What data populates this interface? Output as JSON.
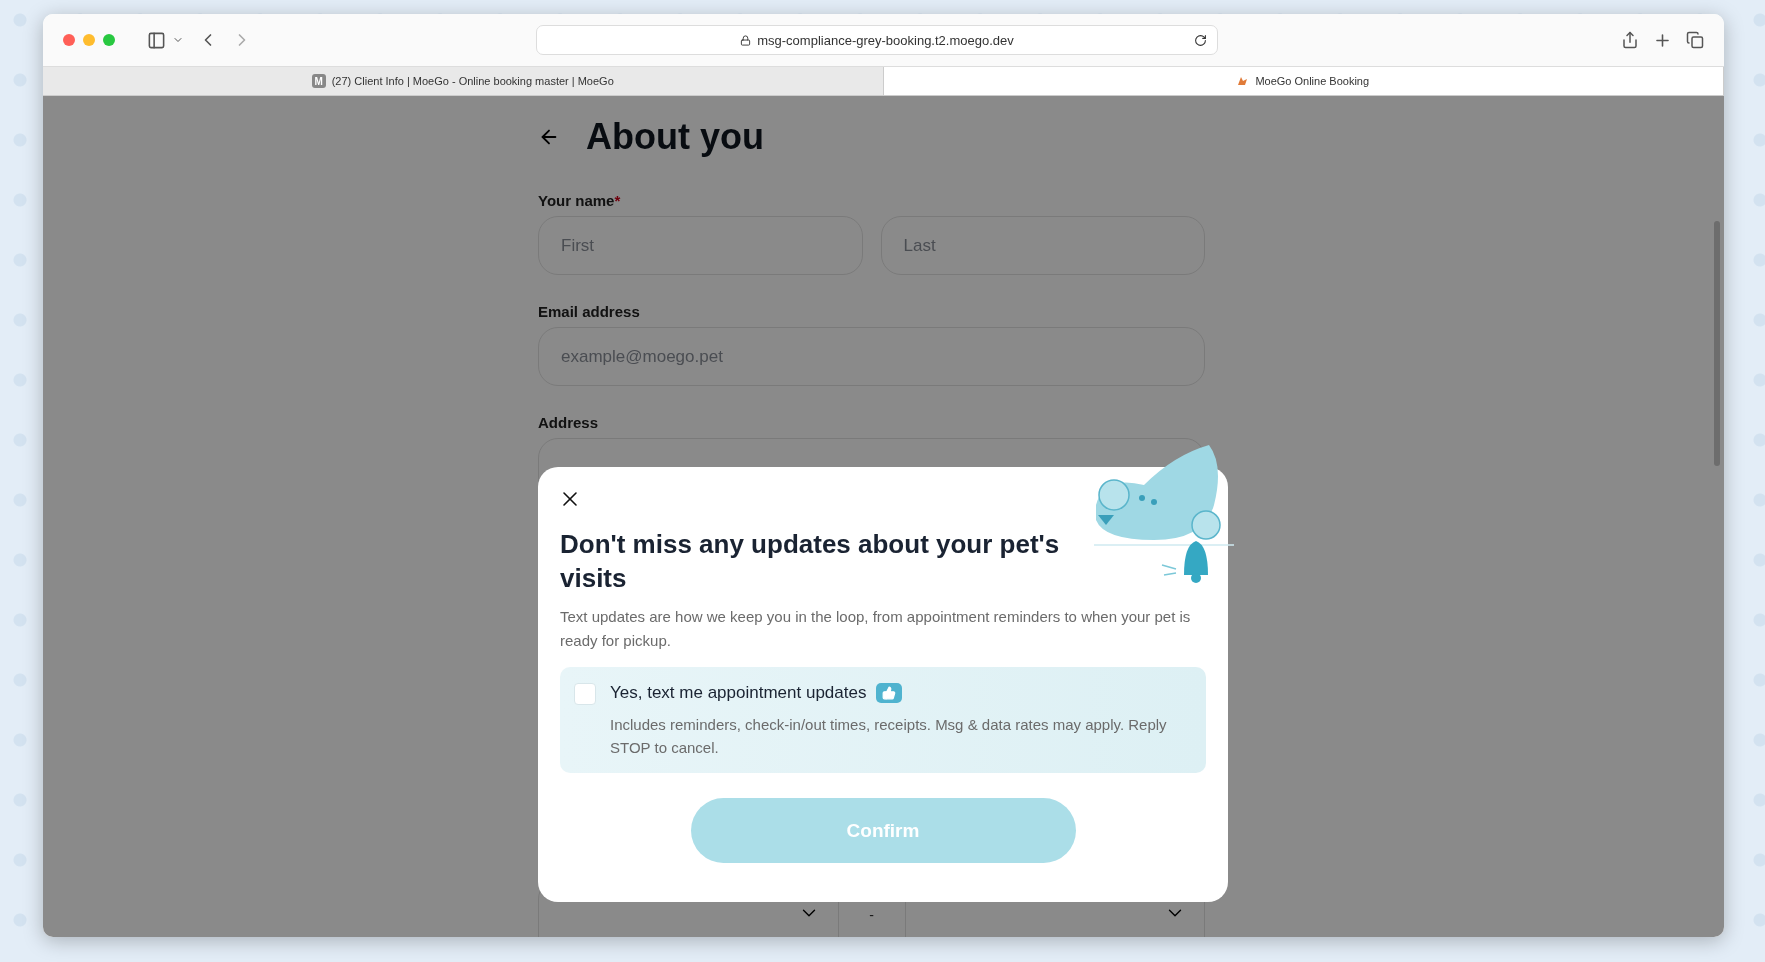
{
  "browser": {
    "url": "msg-compliance-grey-booking.t2.moego.dev",
    "tabs": [
      {
        "favicon": "M",
        "title": "(27) Client Info | MoeGo - Online booking master | MoeGo",
        "selected": false
      },
      {
        "title": "MoeGo Online Booking",
        "selected": true
      }
    ]
  },
  "page": {
    "title": "About you",
    "fields": [
      {
        "label": "Your name",
        "required_mark": "*",
        "inputs": [
          {
            "placeholder": "First"
          },
          {
            "placeholder": "Last"
          }
        ]
      },
      {
        "label": "Email address",
        "inputs": [
          {
            "placeholder": "example@moego.pet"
          }
        ]
      },
      {
        "label": "Address"
      }
    ],
    "range": {
      "separator": "-"
    }
  },
  "modal": {
    "title": "Don't miss any updates about your pet's visits",
    "text": "Text updates are how we keep you in the loop, from appointment reminders to when your pet is ready for pickup.",
    "option": {
      "label": "Yes, text me appointment updates",
      "note": "Includes reminders, check-in/out times, receipts. Msg & data rates may apply. Reply STOP to cancel.",
      "checked": false
    },
    "confirm": {
      "label": "Confirm",
      "disabled": true
    }
  }
}
